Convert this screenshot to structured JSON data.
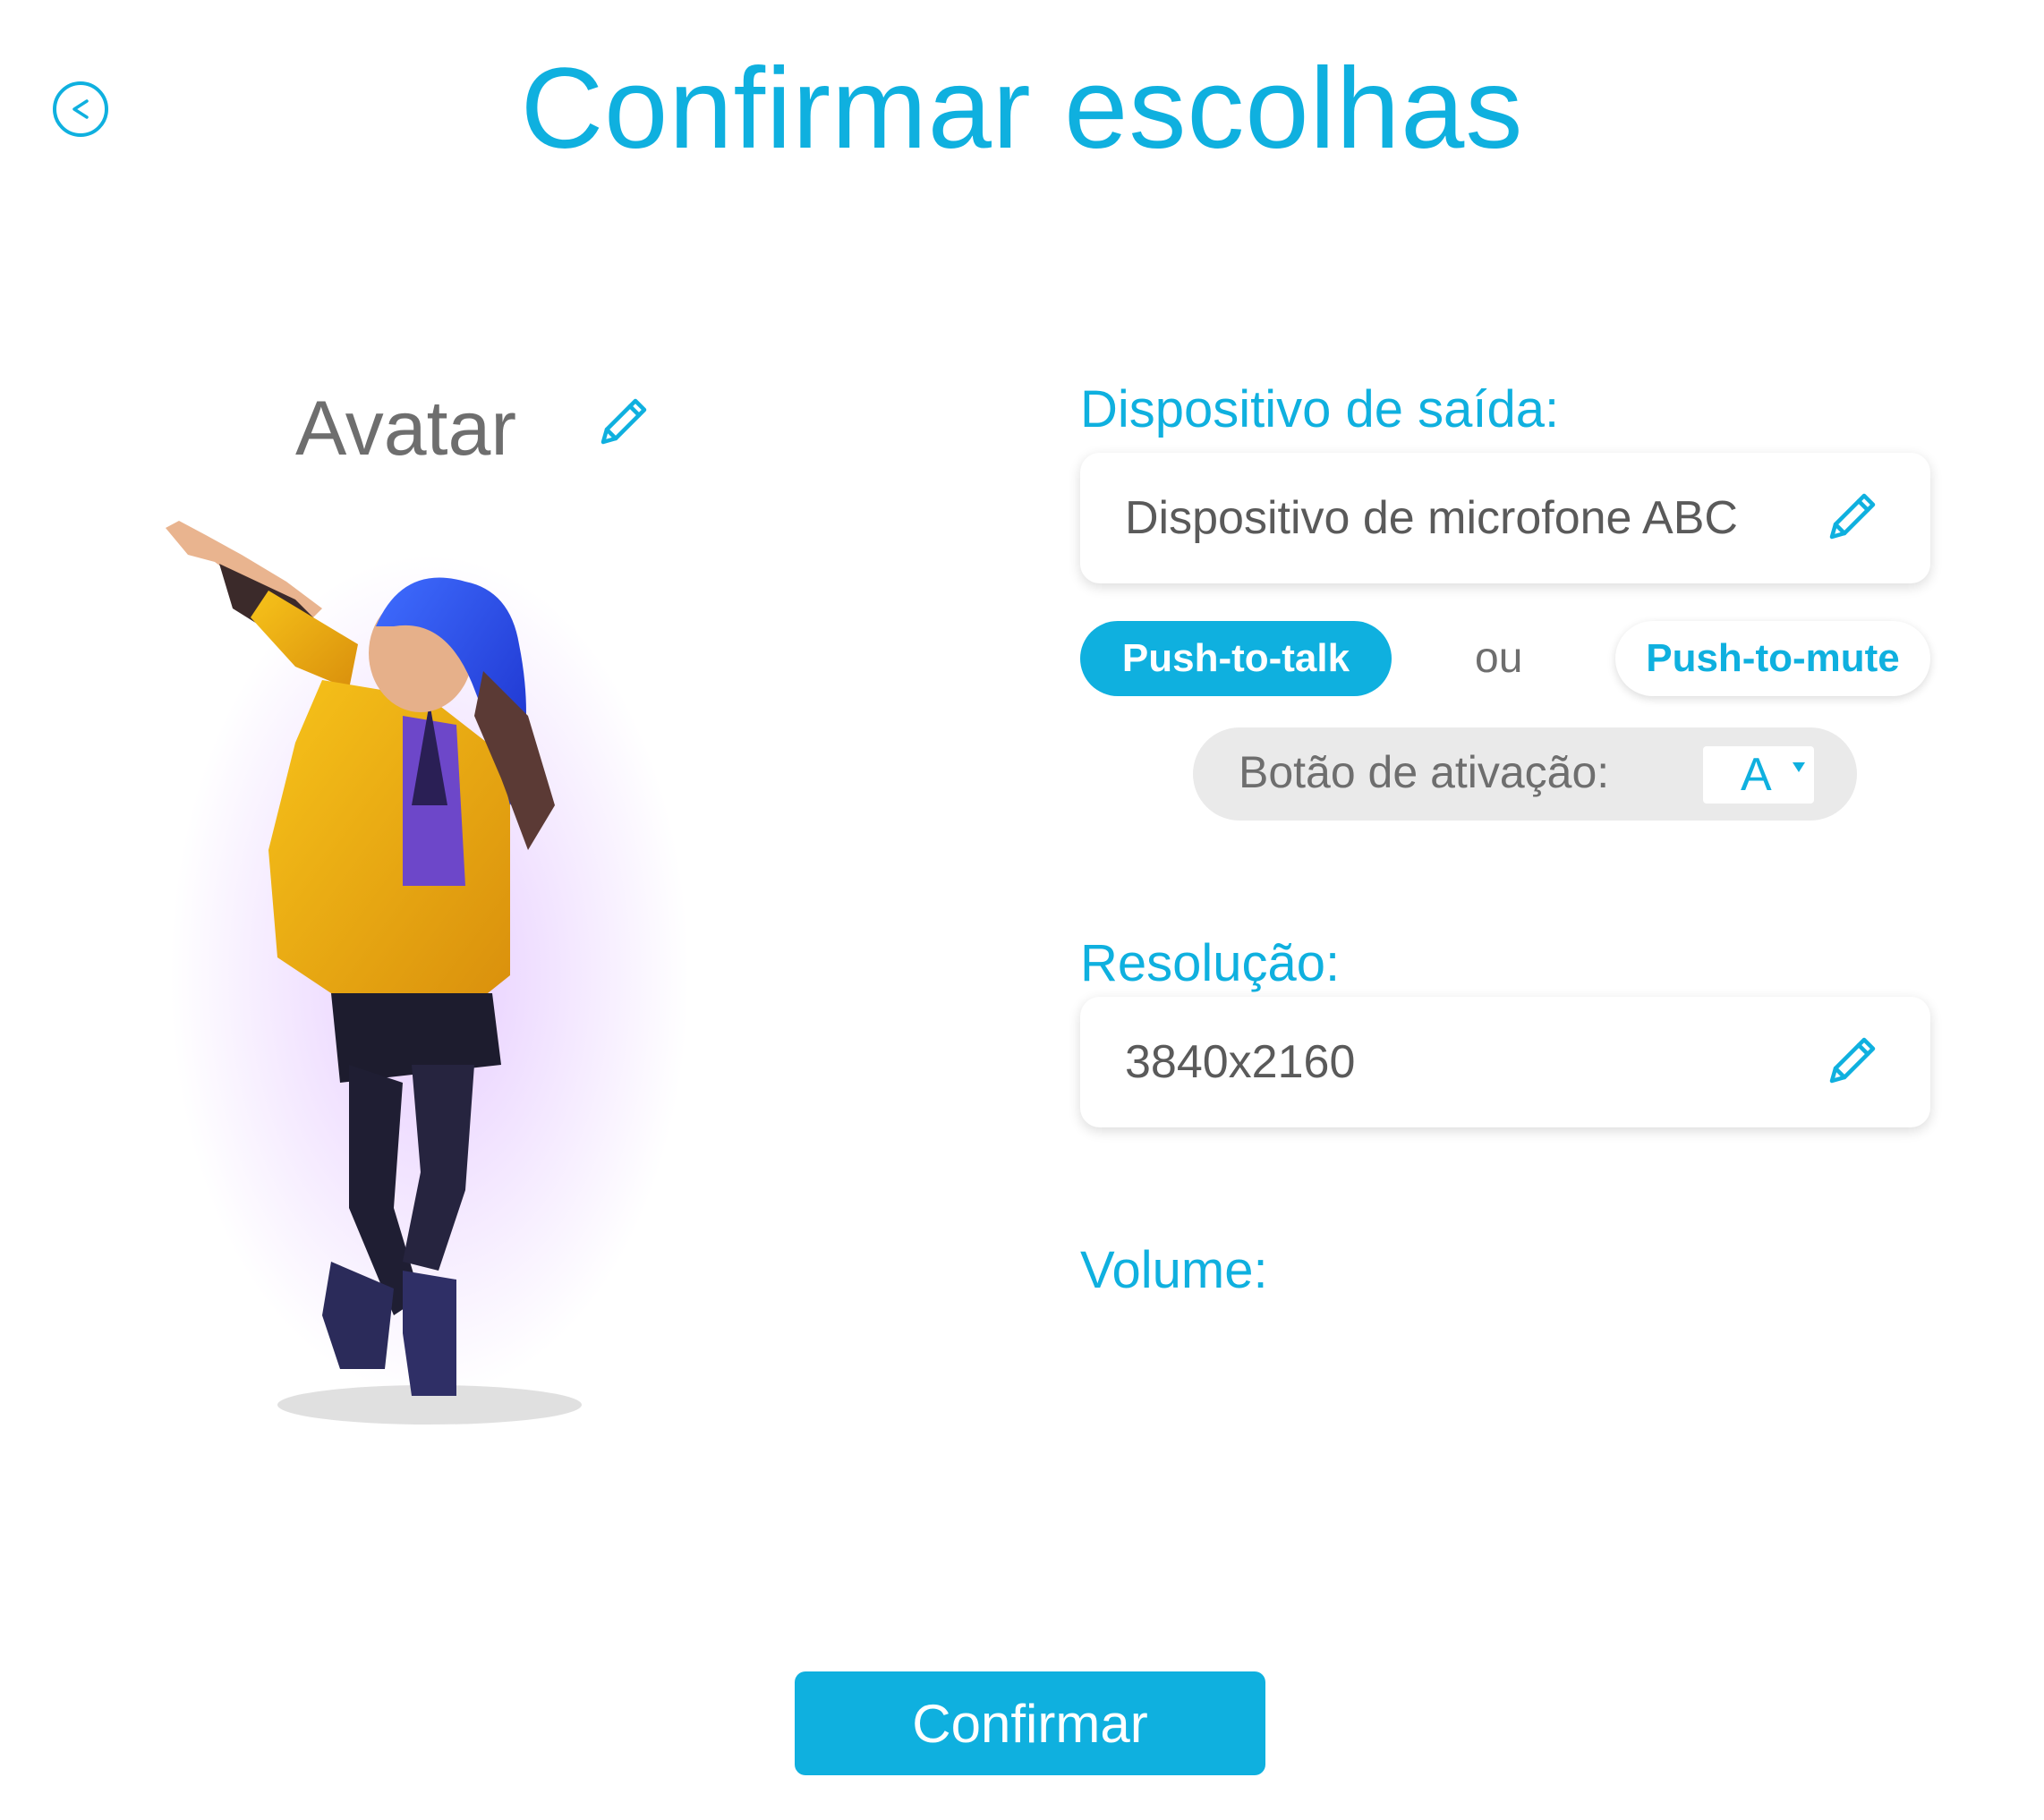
{
  "header": {
    "title": "Confirmar escolhas",
    "back_icon": "chevron-left-circle-icon"
  },
  "avatar": {
    "label": "Avatar",
    "edit_icon": "pencil-icon",
    "figure": "avatar-character-image"
  },
  "output_device": {
    "label": "Dispositivo de saída:",
    "value": "Dispositivo de microfone ABC",
    "edit_icon": "pencil-icon"
  },
  "mode": {
    "push_to_talk": "Push-to-talk",
    "or": "ou",
    "push_to_mute": "Push-to-mute",
    "selected": "Push-to-talk"
  },
  "activation": {
    "label": "Botão de ativação:",
    "value": "A"
  },
  "resolution": {
    "label": "Resolução:",
    "value": "3840x2160",
    "edit_icon": "pencil-icon"
  },
  "volume": {
    "label": "Volume:"
  },
  "footer": {
    "confirm_label": "Confirmar"
  },
  "colors": {
    "accent": "#0fb0df",
    "text_gray": "#6e6e6e",
    "bar_gray": "#eaeaea"
  }
}
